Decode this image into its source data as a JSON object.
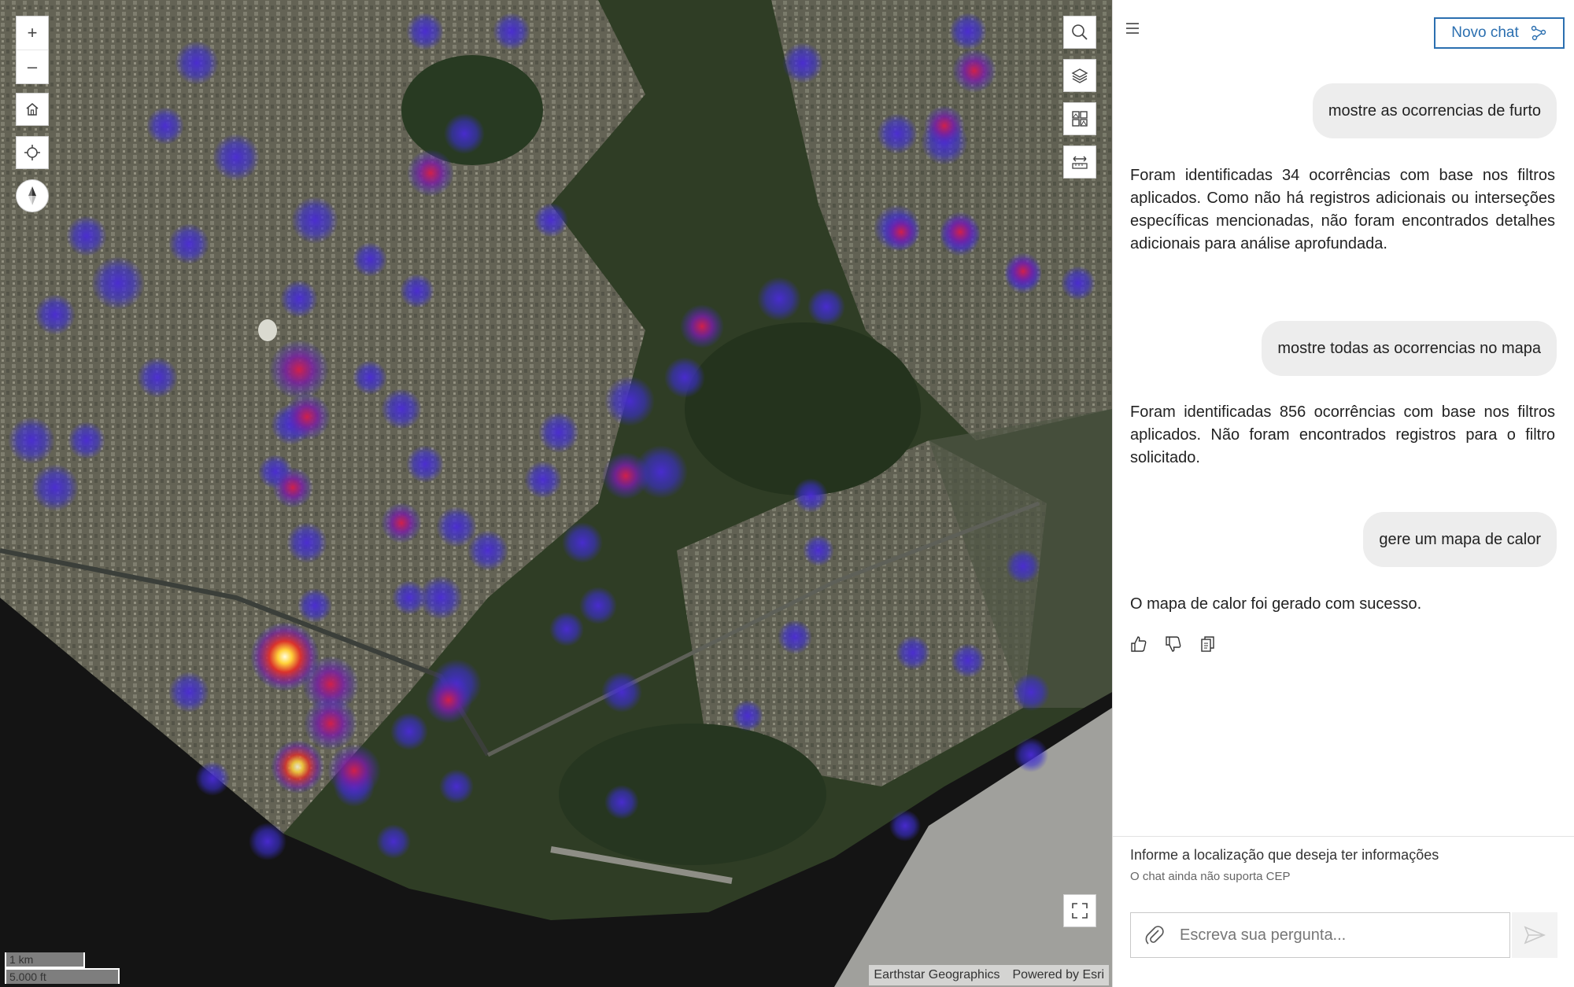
{
  "map": {
    "zoom_in_label": "+",
    "zoom_out_label": "–",
    "attribution": [
      "Earthstar Geographics",
      "Powered by Esri"
    ],
    "scale": {
      "metric": "1 km",
      "imperial": "5.000 ft"
    },
    "icons": {
      "home": "home-icon",
      "locate": "locate-icon",
      "compass": "compass-icon",
      "search": "search-icon",
      "layers": "layers-icon",
      "basemap": "basemap-gallery-icon",
      "measure": "measure-icon",
      "fullscreen": "fullscreen-icon"
    }
  },
  "chat": {
    "new_chat_label": "Novo chat",
    "messages": [
      {
        "role": "user",
        "text": "mostre as ocorrencias de furto"
      },
      {
        "role": "assistant",
        "text": "Foram identificadas 34 ocorrências com base nos filtros aplicados. Como não há registros adicionais ou interseções específicas mencionadas, não foram encontrados detalhes adicionais para análise aprofundada."
      },
      {
        "role": "user",
        "text": "mostre todas as ocorrencias no mapa"
      },
      {
        "role": "assistant",
        "text": "Foram identificadas 856 ocorrências com base nos filtros aplicados. Não foram encontrados registros para o filtro solicitado."
      },
      {
        "role": "user",
        "text": "gere um mapa de calor"
      },
      {
        "role": "assistant",
        "text": "O mapa de calor foi gerado com sucesso."
      }
    ],
    "hint_title": "Informe a localização que deseja ter informações",
    "hint_subtitle": "O chat ainda não suporta CEP",
    "input_placeholder": "Escreva sua pergunta..."
  }
}
